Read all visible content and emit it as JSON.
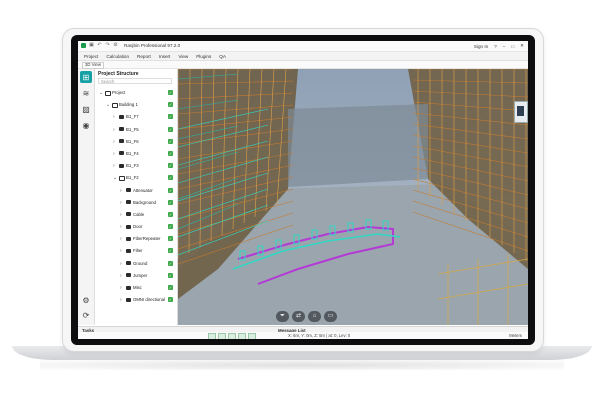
{
  "window": {
    "title": "Ranjbin Professional 97.2.0",
    "sign_in": "Sign In",
    "help": "?"
  },
  "menu": [
    "Project",
    "Calculation",
    "Report",
    "Insert",
    "View",
    "Plugins",
    "QA"
  ],
  "toolbar": {
    "view_select": "3D View"
  },
  "panel": {
    "title": "Project Structure",
    "search_placeholder": "Search",
    "tree": [
      {
        "label": "Project",
        "level": 0,
        "expanded": true
      },
      {
        "label": "Building 1",
        "level": 1,
        "expanded": true
      },
      {
        "label": "B1_F7",
        "level": 2,
        "expanded": false
      },
      {
        "label": "B1_F5",
        "level": 2,
        "expanded": false
      },
      {
        "label": "B1_F6",
        "level": 2,
        "expanded": false
      },
      {
        "label": "B1_F4",
        "level": 2,
        "expanded": false
      },
      {
        "label": "B1_F3",
        "level": 2,
        "expanded": false
      },
      {
        "label": "B1_F2",
        "level": 2,
        "expanded": true
      },
      {
        "label": "Attenuator",
        "level": 3,
        "expanded": false
      },
      {
        "label": "Background",
        "level": 3,
        "expanded": false
      },
      {
        "label": "Cable",
        "level": 3,
        "expanded": false
      },
      {
        "label": "Door",
        "level": 3,
        "expanded": false
      },
      {
        "label": "FiberRepeater",
        "level": 3,
        "expanded": false
      },
      {
        "label": "Filter",
        "level": 3,
        "expanded": false
      },
      {
        "label": "Ground",
        "level": 3,
        "expanded": false
      },
      {
        "label": "Jumper",
        "level": 3,
        "expanded": false
      },
      {
        "label": "Misc",
        "level": 3,
        "expanded": false
      },
      {
        "label": "OMNI directional",
        "level": 3,
        "expanded": false
      }
    ]
  },
  "tasks": {
    "label": "Tasks",
    "message_list": "Message List"
  },
  "status": {
    "coords": "X: 6m, Y: 0m, Z: 5m | at: 0, Lev: 0",
    "units": "Meters"
  },
  "colors": {
    "accent": "#17a1a5",
    "check": "#3ea84a",
    "cyan": "#2fd9c4",
    "magenta": "#b43ad6",
    "orange": "#c77a2e"
  },
  "icons": {
    "rail": [
      "project-structure-icon",
      "layers-icon",
      "hatch-icon",
      "antenna-icon",
      "settings-icon",
      "sync-icon"
    ],
    "viewport": [
      "filter-icon",
      "swap-icon",
      "home-icon",
      "screen-icon"
    ]
  }
}
